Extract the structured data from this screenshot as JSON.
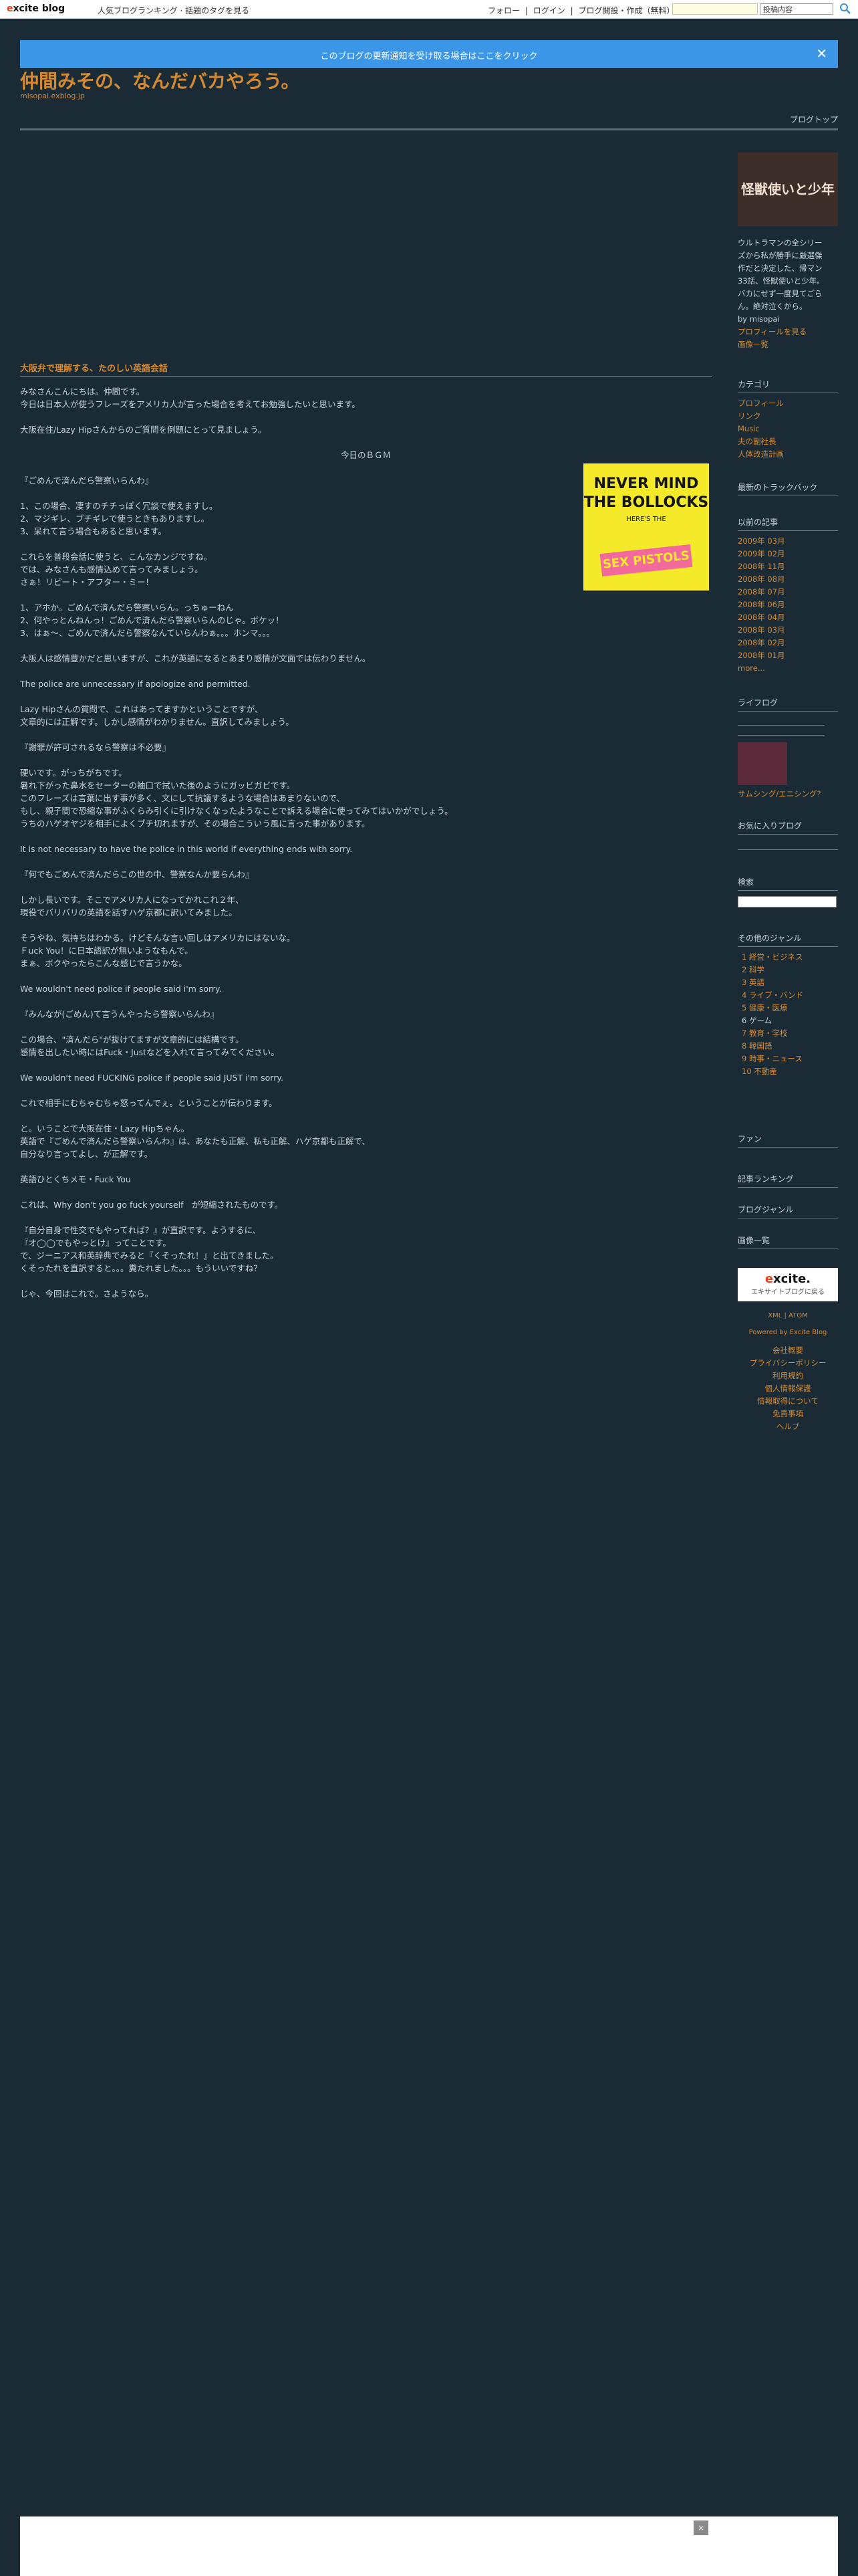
{
  "topbar": {
    "logo_prefix": "e",
    "logo_rest": "xcite blog",
    "tags": "人気ブログランキング · 話題のタグを見る",
    "links": [
      "フォロー",
      "|",
      "ログイン",
      "|",
      "ブログ開設・作成（無料）"
    ],
    "select_value": "投稿内容"
  },
  "notice": {
    "text": "このブログの更新通知を受け取る場合はここをクリック",
    "close": "✕"
  },
  "blog": {
    "title": "仲間みその、なんだバカやろう。",
    "url": "misopai.exblog.jp",
    "top_link": "ブログトップ"
  },
  "post": {
    "title": "大阪弁で理解する、たのしい英語会話",
    "paragraphs": [
      "みなさんこんにちは。仲間です。",
      "今日は日本人が使うフレーズをアメリカ人が言った場合を考えてお勉強したいと思います。",
      "",
      "大阪在住/Lazy Hipさんからのご質問を例題にとって見ましょう。",
      "",
      "今日のＢＧＭ",
      "",
      "『ごめんで済んだら警察いらんわ』",
      "",
      "1、この場合、凄すのチチっぽく冗談で使えますし。",
      "2、マジギレ、ブチギレで使うときもありますし。",
      "3、呆れて言う場合もあると思います。",
      "",
      "これらを普段会話に使うと、こんなカンジですね。",
      "では、みなさんも感情込めて言ってみましょう。",
      "さぁ！リピート・アフター・ミー！",
      "",
      "1、アホか。ごめんで済んだら警察いらん。っちゅーねん",
      "2、何やっとんねんっ！ごめんで済んだら警察いらんのじゃ。ボケッ！",
      "3、はぁ〜、ごめんで済んだら警察なんていらんわぁ。。。ホンマ。。。",
      "",
      "大阪人は感情豊かだと思いますが、これが英語になるとあまり感情が文面では伝わりません。",
      "",
      "The police are unnecessary if apologize and permitted.",
      "",
      "Lazy Hipさんの質問で、これはあってますかということですが、",
      "文章的には正解です。しかし感情がわかりません。直訳してみましょう。",
      "",
      "『謝罪が許可されるなら警察は不必要』",
      "",
      "硬いです。がっちがちです。",
      "暑れ下がった鼻水をセーターの袖口で拭いた後のようにガッビガビです。",
      "このフレーズは言葉に出す事が多く、文にして抗議するような場合はあまりないので、",
      "もし、親子間で恐縮な事がふくらみ引くに引けなくなったようなことで訴える場合に使ってみてはいかがでしょう。",
      "うちのハゲオヤジを相手によくブチ切れますが、その場合こういう風に言った事があります。",
      "",
      "It is not necessary to have the police in this world if everything ends with sorry.",
      "",
      "『何でもごめんで済んだらこの世の中、警察なんか要らんわ』",
      "",
      "しかし長いです。そこでアメリカ人になってかれこれ２年、",
      "現役でバリバリの英語を話すハゲ京都に訳いてみました。",
      "",
      "そうやね、気持ちはわかる。けどそんな言い回しはアメリカにはないな。",
      "Ｆuck You！に日本語訳が無いようなもんで。",
      "まぁ、ボクやったらこんな感じで言うかな。",
      "",
      "We wouldn't need police if people said i'm sorry.",
      "",
      "『みんなが(ごめん)て言うんやったら警察いらんわ』",
      "",
      "この場合、\"済んだら\"が抜けてますが文章的には結構です。",
      "感情を出したい時にはFuck・Justなどを入れて言ってみてください。",
      "",
      "We wouldn't need FUCKING police if people said JUST i'm sorry.",
      "",
      "これで相手にむちゃむちゃ怒ってんでぇ。ということが伝わります。",
      "",
      "と。いうことで大阪在住・Lazy Hipちゃん。",
      "英語で『ごめんで済んだら警察いらんわ』は、あなたも正解、私も正解、ハゲ京都も正解で、",
      "自分なり言ってよし、が正解です。",
      "",
      "英語ひとくちメモ・Fuck You",
      "",
      "これは、Why don't you go fuck yourself　が短縮されたものです。",
      "",
      "『自分自身で性交でもやってれば？』が直訳です。ようするに、",
      "『オ◯◯でもやっとけ』ってことです。",
      "で、ジーニアス和英辞典でみると『くそったれ！』と出てきました。",
      "くそったれを直訳すると。。。糞たれました。。。もういいですね？",
      "",
      "じゃ、今回はこれで。さようなら。"
    ],
    "album": {
      "line1": "NEVER MIND",
      "line2": "THE BOLLOCKS",
      "line3": "HERE'S THE",
      "line4": "SEX PISTOLS"
    }
  },
  "sidebar": {
    "profile_image_text": "怪獣使いと少年",
    "profile_text": [
      "ウルトラマンの全シリー",
      "ズから私が勝手に厳選傑",
      "作だと決定した、帰マン",
      "33話、怪獣使いと少年。",
      "バカにせず一度見てごら",
      "ん。絶対泣くから。",
      "by misopai"
    ],
    "profile_link": "プロフィールを見る",
    "image_list": "画像一覧",
    "categories_title": "カテゴリ",
    "categories": [
      "プロフィール",
      "リンク",
      "Music",
      "夫の副社長",
      "人体改造計画"
    ],
    "trackback_title": "最新のトラックバック",
    "archive_title": "以前の記事",
    "archive": [
      "2009年 03月",
      "2009年 02月",
      "2008年 11月",
      "2008年 08月",
      "2008年 07月",
      "2008年 06月",
      "2008年 04月",
      "2008年 03月",
      "2008年 02月",
      "2008年 01月",
      "more..."
    ],
    "lifelog_title": "ライフログ",
    "lifelog_item": "サムシング/エニシング?",
    "favorites_title": "お気に入りブログ",
    "search_title": "検索",
    "genre_title": "その他のジャンル",
    "genres": [
      "1 経営・ビジネス",
      "2 科学",
      "3 英語",
      "4 ライブ・バンド",
      "5 健康・医療",
      "6 ゲーム",
      "7 教育・学校",
      "8 韓国語",
      "9 時事・ニュース",
      "10 不動産"
    ],
    "fan_title": "ファン",
    "ranking_title": "記事ランキング",
    "genre2_title": "ブログジャンル",
    "images_title": "画像一覧",
    "excite_logo_prefix": "e",
    "excite_logo_rest": "xcite.",
    "excite_sub": "エキサイトブログに戻る",
    "feeds": "XML | ATOM",
    "powered": "Powered by Excite Blog",
    "footer_links": [
      "会社概要",
      "プライバシーポリシー",
      "利用規約",
      "個人情報保護",
      "情報取得について",
      "免責事項",
      "ヘルプ"
    ]
  },
  "footer": {
    "close": "×"
  }
}
